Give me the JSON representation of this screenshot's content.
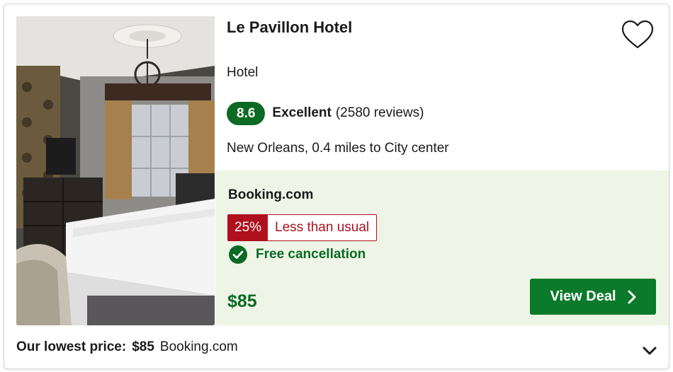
{
  "hotel": {
    "name": "Le Pavillon Hotel",
    "type": "Hotel",
    "score": "8.6",
    "rating_word": "Excellent",
    "reviews": "(2580 reviews)",
    "location": "New Orleans, 0.4 miles to City center"
  },
  "deal": {
    "provider": "Booking.com",
    "discount_pct": "25%",
    "discount_text": "Less than usual",
    "cancellation": "Free cancellation",
    "price": "$85",
    "button_label": "View Deal"
  },
  "footer": {
    "label": "Our lowest price:",
    "price": "$85",
    "provider": "Booking.com"
  },
  "colors": {
    "brand_green": "#0b6a23",
    "discount_red": "#b0101e",
    "deal_bg": "#eef5e6"
  },
  "icons": [
    "heart-icon",
    "check-circle-icon",
    "chevron-right-icon",
    "chevron-down-icon"
  ]
}
